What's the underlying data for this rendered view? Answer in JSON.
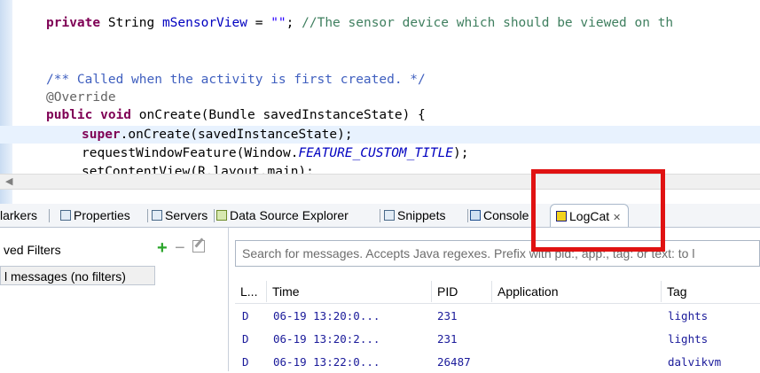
{
  "editor": {
    "lines": [
      {
        "id": "l1"
      },
      {
        "id": "l2"
      }
    ],
    "line1": {
      "kw": "private",
      "type": " String ",
      "var": "mSensorView",
      "eq": " = ",
      "str": "\"\"",
      "semi": "; ",
      "comment": "//The sensor device which should be viewed on th"
    },
    "line2": {
      "javadoc": "/** Called when the activity is first created. */"
    },
    "line3": {
      "annotation": "@Override"
    },
    "line4": {
      "kw1": "public",
      "kw2": " void",
      "rest": " onCreate(Bundle savedInstanceState) {"
    },
    "line5": {
      "kw": "super",
      "rest": ".onCreate(savedInstanceState);"
    },
    "line6": {
      "pre": "requestWindowFeature(Window.",
      "field": "FEATURE_CUSTOM_TITLE",
      "post": ");"
    },
    "line7": {
      "text": "setContentView(R.layout.main);"
    }
  },
  "scrollbar": {
    "left_arrow": "◀"
  },
  "tabs": [
    {
      "label": "Markers",
      "display": "larkers"
    },
    {
      "label": "Properties"
    },
    {
      "label": "Servers"
    },
    {
      "label": "Data Source Explorer"
    },
    {
      "label": "Snippets"
    },
    {
      "label": "Console"
    },
    {
      "label": "LogCat",
      "close": "✕"
    }
  ],
  "filters": {
    "title": "ved Filters",
    "all_messages": "l messages (no filters)",
    "add_icon": "+",
    "remove_icon": "−"
  },
  "logcat": {
    "search_placeholder": "Search for messages. Accepts Java regexes. Prefix with pid:, app:, tag: or text: to l",
    "columns": [
      "L...",
      "Time",
      "PID",
      "Application",
      "Tag"
    ],
    "rows": [
      {
        "level": "D",
        "time": "06-19 13:20:0...",
        "pid": "231",
        "app": "",
        "tag": "lights"
      },
      {
        "level": "D",
        "time": "06-19 13:20:2...",
        "pid": "231",
        "app": "",
        "tag": "lights"
      },
      {
        "level": "D",
        "time": "06-19 13:22:0...",
        "pid": "26487",
        "app": "",
        "tag": "dalvikvm"
      }
    ]
  },
  "colors": {
    "highlight_box": "#e01212",
    "keyword": "#7f0055",
    "comment": "#3f7f5f",
    "javadoc": "#3f5fbf"
  }
}
